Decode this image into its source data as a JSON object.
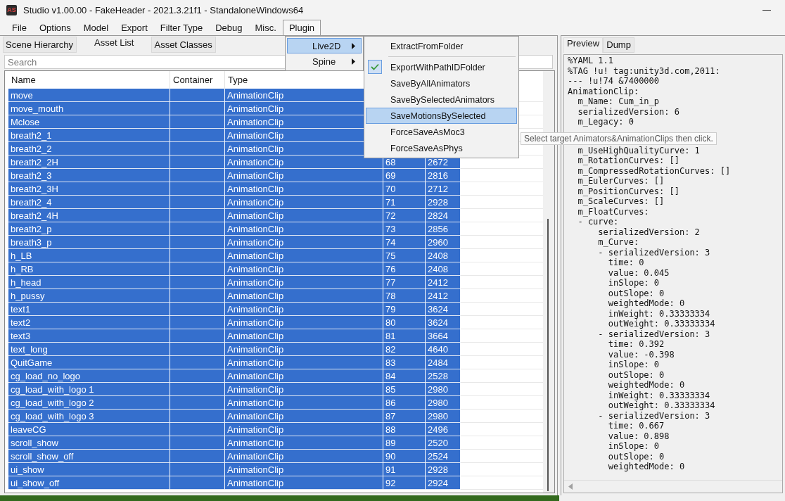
{
  "window": {
    "icon_text": "AS",
    "title": "Studio v1.00.00 - FakeHeader - 2021.3.21f1 - StandaloneWindows64"
  },
  "menubar": [
    {
      "label": "File",
      "selected": false
    },
    {
      "label": "Options",
      "selected": false
    },
    {
      "label": "Model",
      "selected": false
    },
    {
      "label": "Export",
      "selected": false
    },
    {
      "label": "Filter Type",
      "selected": false
    },
    {
      "label": "Debug",
      "selected": false
    },
    {
      "label": "Misc.",
      "selected": false
    },
    {
      "label": "Plugin",
      "selected": true
    }
  ],
  "plugin_menu": [
    {
      "label": "Live2D",
      "selected": true
    },
    {
      "label": "Spine",
      "selected": false
    }
  ],
  "live2d_submenu": [
    {
      "label": "ExtractFromFolder",
      "checked": false,
      "selected": false,
      "separator_after": true
    },
    {
      "label": "ExportWithPathIDFolder",
      "checked": true,
      "selected": false,
      "separator_after": false
    },
    {
      "label": "SaveByAllAnimators",
      "checked": false,
      "selected": false,
      "separator_after": false
    },
    {
      "label": "SaveBySelectedAnimators",
      "checked": false,
      "selected": false,
      "separator_after": false
    },
    {
      "label": "SaveMotionsBySelected",
      "checked": false,
      "selected": true,
      "separator_after": false
    },
    {
      "label": "ForceSaveAsMoc3",
      "checked": false,
      "selected": false,
      "separator_after": false
    },
    {
      "label": "ForceSaveAsPhys",
      "checked": false,
      "selected": false,
      "separator_after": false
    }
  ],
  "tooltip": "Select target Animators&AnimationClips then click.",
  "left_tabs": [
    {
      "label": "Scene Hierarchy",
      "selected": false
    },
    {
      "label": "Asset List",
      "selected": true
    },
    {
      "label": "Asset Classes",
      "selected": false
    }
  ],
  "search": {
    "placeholder": "Search"
  },
  "table": {
    "columns": [
      "Name",
      "Container",
      "Type"
    ],
    "rows": [
      {
        "name": "move",
        "type": "AnimationClip",
        "selected": true
      },
      {
        "name": "move_mouth",
        "type": "AnimationClip",
        "selected": true
      },
      {
        "name": "Mclose",
        "type": "AnimationClip",
        "selected": true
      },
      {
        "name": "breath2_1",
        "type": "AnimationClip",
        "selected": true
      },
      {
        "name": "breath2_2",
        "type": "AnimationClip",
        "selected": true
      },
      {
        "name": "breath2_2H",
        "type": "AnimationClip",
        "column_4": "68",
        "column_5": "2672",
        "selected": true
      },
      {
        "name": "breath2_3",
        "type": "AnimationClip",
        "column_4": "69",
        "column_5": "2816",
        "selected": true
      },
      {
        "name": "breath2_3H",
        "type": "AnimationClip",
        "column_4": "70",
        "column_5": "2712",
        "selected": true
      },
      {
        "name": "breath2_4",
        "type": "AnimationClip",
        "column_4": "71",
        "column_5": "2928",
        "selected": true
      },
      {
        "name": "breath2_4H",
        "type": "AnimationClip",
        "column_4": "72",
        "column_5": "2824",
        "selected": true
      },
      {
        "name": "breath2_p",
        "type": "AnimationClip",
        "column_4": "73",
        "column_5": "2856",
        "selected": true
      },
      {
        "name": "breath3_p",
        "type": "AnimationClip",
        "column_4": "74",
        "column_5": "2960",
        "selected": true
      },
      {
        "name": "h_LB",
        "type": "AnimationClip",
        "column_4": "75",
        "column_5": "2408",
        "selected": true
      },
      {
        "name": "h_RB",
        "type": "AnimationClip",
        "column_4": "76",
        "column_5": "2408",
        "selected": true
      },
      {
        "name": "h_head",
        "type": "AnimationClip",
        "column_4": "77",
        "column_5": "2412",
        "selected": true
      },
      {
        "name": "h_pussy",
        "type": "AnimationClip",
        "column_4": "78",
        "column_5": "2412",
        "selected": true
      },
      {
        "name": "text1",
        "type": "AnimationClip",
        "column_4": "79",
        "column_5": "3624",
        "selected": true
      },
      {
        "name": "text2",
        "type": "AnimationClip",
        "column_4": "80",
        "column_5": "3624",
        "selected": true
      },
      {
        "name": "text3",
        "type": "AnimationClip",
        "column_4": "81",
        "column_5": "3664",
        "selected": true
      },
      {
        "name": "text_long",
        "type": "AnimationClip",
        "column_4": "82",
        "column_5": "4640",
        "selected": true
      },
      {
        "name": "QuitGame",
        "type": "AnimationClip",
        "column_4": "83",
        "column_5": "2484",
        "selected": true
      },
      {
        "name": "cg_load_no_logo",
        "type": "AnimationClip",
        "column_4": "84",
        "column_5": "2528",
        "selected": true
      },
      {
        "name": "cg_load_with_logo 1",
        "type": "AnimationClip",
        "column_4": "85",
        "column_5": "2980",
        "selected": true
      },
      {
        "name": "cg_load_with_logo 2",
        "type": "AnimationClip",
        "column_4": "86",
        "column_5": "2980",
        "selected": true
      },
      {
        "name": "cg_load_with_logo 3",
        "type": "AnimationClip",
        "column_4": "87",
        "column_5": "2980",
        "selected": true
      },
      {
        "name": "leaveCG",
        "type": "AnimationClip",
        "column_4": "88",
        "column_5": "2496",
        "selected": true
      },
      {
        "name": "scroll_show",
        "type": "AnimationClip",
        "column_4": "89",
        "column_5": "2520",
        "selected": true
      },
      {
        "name": "scroll_show_off",
        "type": "AnimationClip",
        "column_4": "90",
        "column_5": "2524",
        "selected": true
      },
      {
        "name": "ui_show",
        "type": "AnimationClip",
        "column_4": "91",
        "column_5": "2928",
        "selected": true
      },
      {
        "name": "ui_show_off",
        "type": "AnimationClip",
        "column_4": "92",
        "column_5": "2924",
        "selected": true
      }
    ]
  },
  "right_tabs": [
    {
      "label": "Preview",
      "selected": true
    },
    {
      "label": "Dump",
      "selected": false
    }
  ],
  "preview_lines": [
    {
      "kind": "text",
      "text": "%YAML 1.1"
    },
    {
      "kind": "text",
      "text": "%TAG !u! tag:unity3d.com,2011:"
    },
    {
      "kind": "text",
      "text": "--- !u!74 &7400000"
    },
    {
      "kind": "text",
      "text": "AnimationClip:"
    },
    {
      "kind": "text",
      "text": "  m_Name: Cum_in_p"
    },
    {
      "kind": "text",
      "text": "  serializedVersion: 6"
    },
    {
      "kind": "text",
      "text": "  m_Legacy: 0"
    },
    {
      "kind": "covered"
    },
    {
      "kind": "text",
      "text": "  m_UseHighQualityCurve: 1"
    },
    {
      "kind": "text",
      "text": "  m_RotationCurves: []"
    },
    {
      "kind": "text",
      "text": "  m_CompressedRotationCurves: []"
    },
    {
      "kind": "text",
      "text": "  m_EulerCurves: []"
    },
    {
      "kind": "text",
      "text": "  m_PositionCurves: []"
    },
    {
      "kind": "text",
      "text": "  m_ScaleCurves: []"
    },
    {
      "kind": "text",
      "text": "  m_FloatCurves:"
    },
    {
      "kind": "text",
      "text": "  - curve:"
    },
    {
      "kind": "text",
      "text": "      serializedVersion: 2"
    },
    {
      "kind": "text",
      "text": "      m_Curve:"
    },
    {
      "kind": "text",
      "text": "      - serializedVersion: 3"
    },
    {
      "kind": "text",
      "text": "        time: 0"
    },
    {
      "kind": "text",
      "text": "        value: 0.045"
    },
    {
      "kind": "text",
      "text": "        inSlope: 0"
    },
    {
      "kind": "text",
      "text": "        outSlope: 0"
    },
    {
      "kind": "text",
      "text": "        weightedMode: 0"
    },
    {
      "kind": "text",
      "text": "        inWeight: 0.33333334"
    },
    {
      "kind": "text",
      "text": "        outWeight: 0.33333334"
    },
    {
      "kind": "text",
      "text": "      - serializedVersion: 3"
    },
    {
      "kind": "text",
      "text": "        time: 0.392"
    },
    {
      "kind": "text",
      "text": "        value: -0.398"
    },
    {
      "kind": "text",
      "text": "        inSlope: 0"
    },
    {
      "kind": "text",
      "text": "        outSlope: 0"
    },
    {
      "kind": "text",
      "text": "        weightedMode: 0"
    },
    {
      "kind": "text",
      "text": "        inWeight: 0.33333334"
    },
    {
      "kind": "text",
      "text": "        outWeight: 0.33333334"
    },
    {
      "kind": "text",
      "text": "      - serializedVersion: 3"
    },
    {
      "kind": "text",
      "text": "        time: 0.667"
    },
    {
      "kind": "text",
      "text": "        value: 0.898"
    },
    {
      "kind": "text",
      "text": "        inSlope: 0"
    },
    {
      "kind": "text",
      "text": "        outSlope: 0"
    },
    {
      "kind": "text",
      "text": "        weightedMode: 0"
    }
  ]
}
